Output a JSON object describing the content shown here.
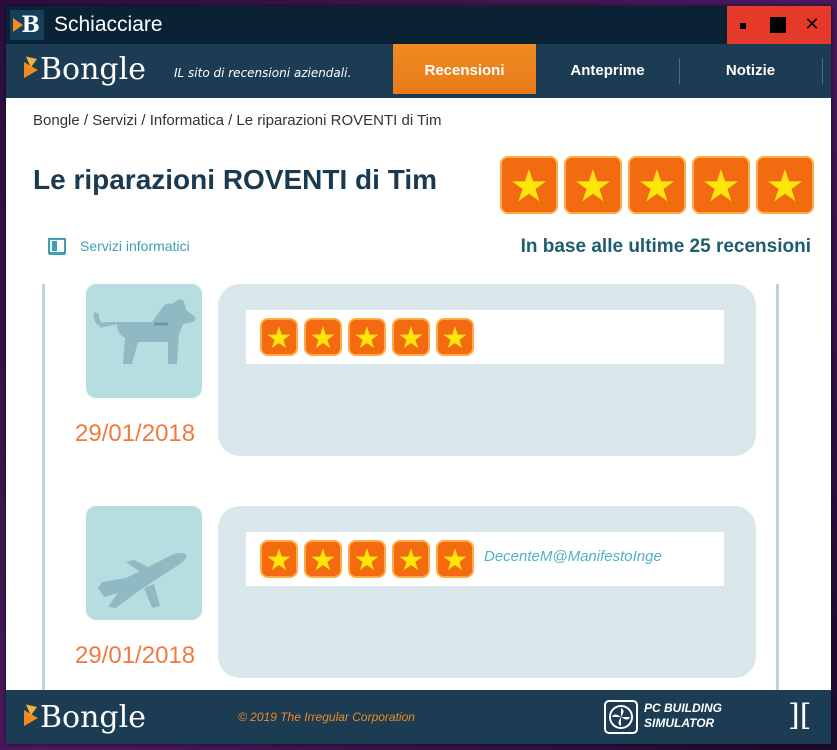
{
  "window": {
    "title": "Schiacciare",
    "icon_letter": "B"
  },
  "navbar": {
    "brand": "Bongle",
    "tagline": "IL sito di recensioni aziendali.",
    "tabs": [
      {
        "label": "Recensioni",
        "active": true
      },
      {
        "label": "Anteprime",
        "active": false
      },
      {
        "label": "Notizie",
        "active": false
      }
    ]
  },
  "breadcrumb": "Bongle / Servizi / Informatica / Le riparazioni ROVENTI di Tim",
  "business": {
    "name": "Le riparazioni ROVENTI di Tim",
    "rating": 5,
    "max_rating": 5,
    "category": "Servizi informatici",
    "basis_text": "In base alle ultime 25 recensioni"
  },
  "reviews": [
    {
      "avatar": "dog-icon",
      "date": "29/01/2018",
      "rating": 5,
      "reviewer": ""
    },
    {
      "avatar": "airplane-icon",
      "date": "29/01/2018",
      "rating": 5,
      "reviewer": "DecenteM@ManifestoInge"
    }
  ],
  "footer": {
    "brand": "Bongle",
    "copyright": "© 2019 The Irregular Corporation",
    "game_logo_line1": "PC BUILDING",
    "game_logo_line2": "SIMULATOR"
  },
  "colors": {
    "navy": "#1b3c52",
    "orange": "#f08a22",
    "star_box": "#f36a10",
    "star": "#ffe60a",
    "date": "#f07a40",
    "teal": "#1e5d6e"
  }
}
